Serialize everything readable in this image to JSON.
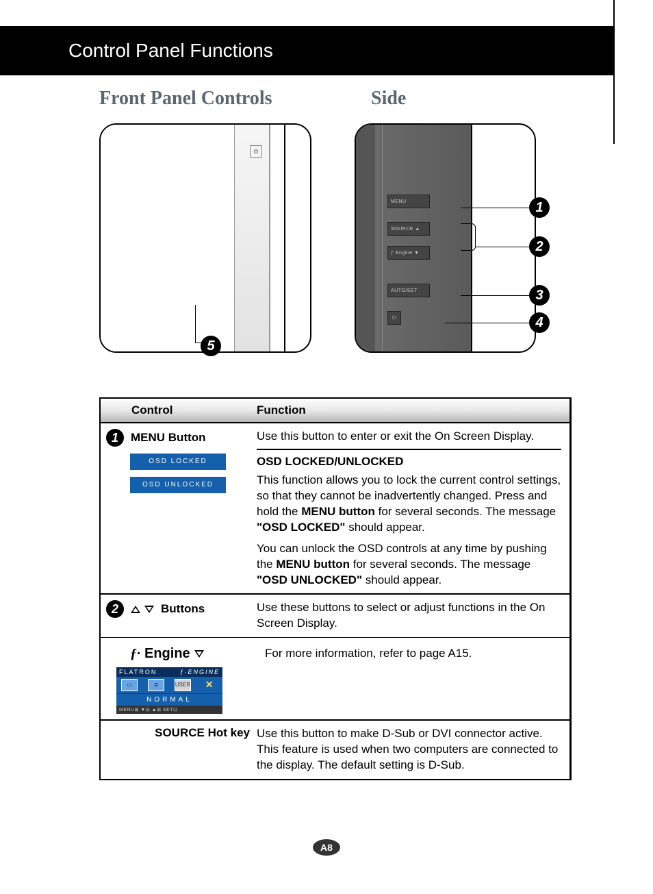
{
  "header": {
    "title": "Control Panel Functions"
  },
  "sections": {
    "front": "Front Panel Controls",
    "side": "Side"
  },
  "side_buttons": {
    "menu": "MENU",
    "source": "SOURCE ▲",
    "fengine": "ƒ Engine ▼",
    "autoset": "AUTO/SET",
    "power": "⏻"
  },
  "callouts": {
    "c1": "1",
    "c2": "2",
    "c3": "3",
    "c4": "4",
    "c5": "5"
  },
  "table": {
    "head_control": "Control",
    "head_function": "Function",
    "row1": {
      "label": "MENU Button",
      "desc": "Use this button to enter or exit the On Screen Display.",
      "osd_title": "OSD LOCKED/UNLOCKED",
      "osd_p1a": "This function allows you to lock the current control settings, so that they cannot be inadvertently changed. Press and hold the ",
      "osd_p1b": "MENU button",
      "osd_p1c": " for several seconds. The message ",
      "osd_p1d": "\"OSD LOCKED\"",
      "osd_p1e": " should appear.",
      "osd_p2a": "You can unlock the OSD controls at any time by pushing the ",
      "osd_p2b": "MENU button",
      "osd_p2c": " for several seconds. The message ",
      "osd_p2d": "\"OSD UNLOCKED\"",
      "osd_p2e": " should appear.",
      "chip_locked": "OSD LOCKED",
      "chip_unlocked": "OSD UNLOCKED"
    },
    "row2": {
      "label": "Buttons",
      "desc": "Use these buttons to select or adjust functions in the On Screen Display.",
      "fengine_label": "Engine",
      "fengine_desc": "For more information, refer to page A15.",
      "fe_topL": "FLATRON",
      "fe_topR": "ƒ·ENGINE",
      "fe_user": "USER",
      "fe_normal": "NORMAL",
      "fe_bot": "MENU⊠   ▼⊟   ▲⊞   SET⊡",
      "source_label": "SOURCE Hot key",
      "source_desc": "Use this button to make D-Sub or DVI connector active. This feature is used when two computers are connected to the display. The default setting is D-Sub."
    }
  },
  "page": "A8"
}
